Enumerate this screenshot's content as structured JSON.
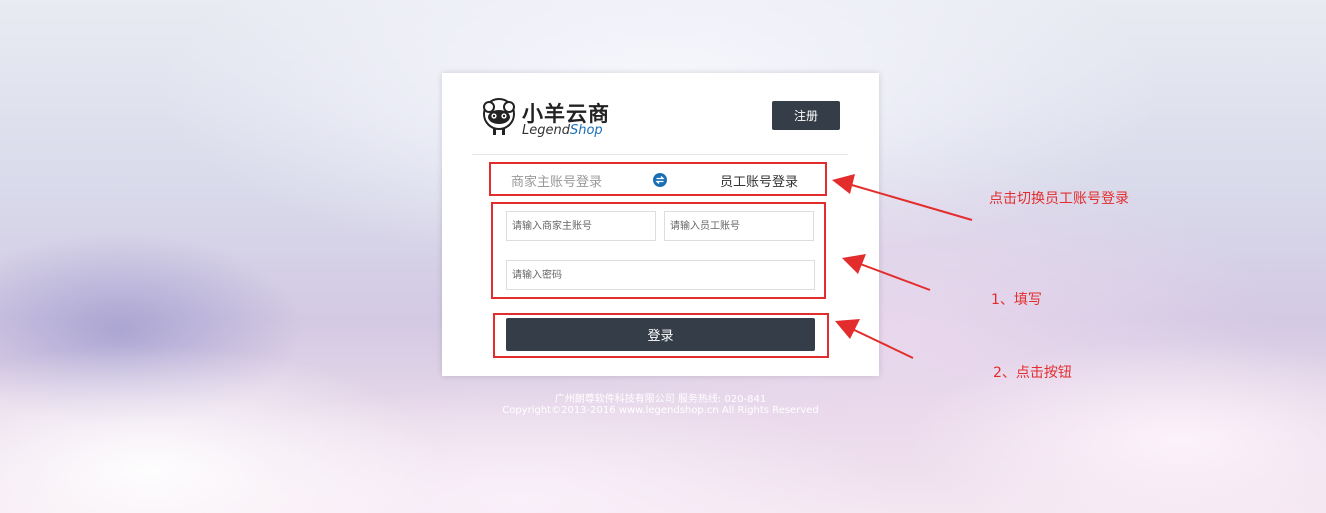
{
  "header": {
    "logo_cn": "小羊云商",
    "logo_en_prefix": "Legend",
    "logo_en_suffix": "Shop",
    "register_label": "注册"
  },
  "tabs": {
    "merchant_label": "商家主账号登录",
    "employee_label": "员工账号登录"
  },
  "form": {
    "merchant_account_placeholder": "请输入商家主账号",
    "employee_account_placeholder": "请输入员工账号",
    "password_placeholder": "请输入密码",
    "login_label": "登录"
  },
  "footer": {
    "line1": "广州朗尊软件科技有限公司   服务热线: 020-841",
    "line2": "Copyright©2013-2016   www.legendshop.cn   All Rights Reserved"
  },
  "annotations": {
    "switch_note": "点击切换员工账号登录",
    "fill_note": "1、填写",
    "click_note": "2、点击按钮"
  },
  "colors": {
    "annotation_red": "#e32d2d",
    "button_dark": "#343d48",
    "brand_blue": "#1c6fb7"
  }
}
